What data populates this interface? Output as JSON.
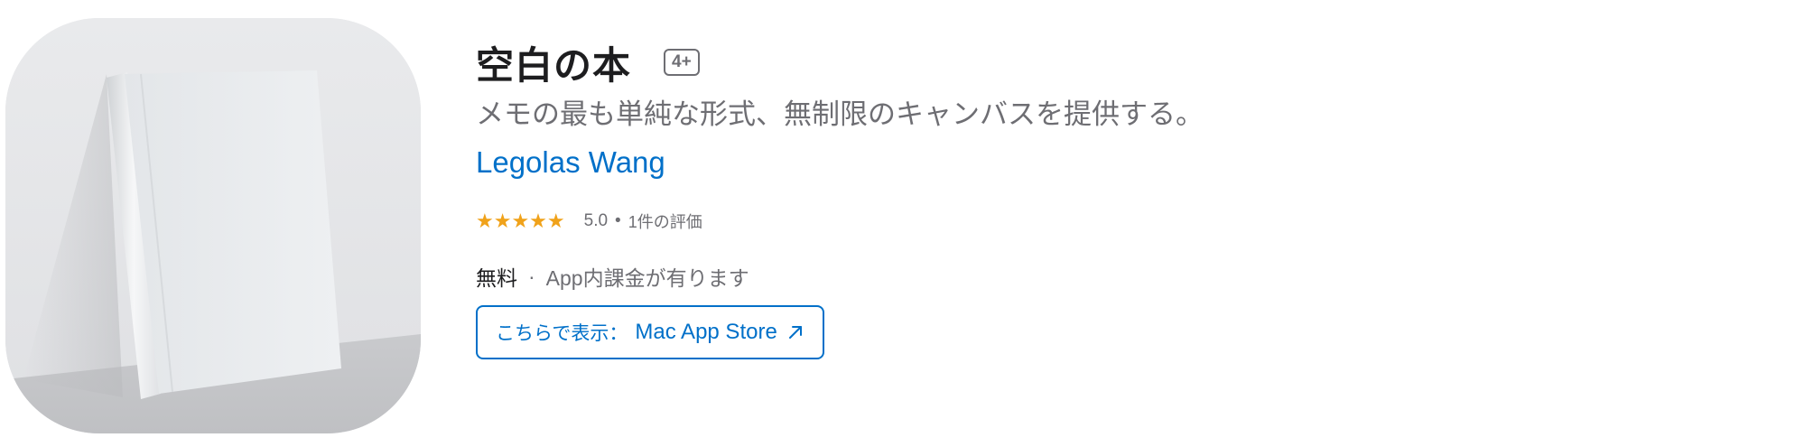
{
  "app": {
    "title": "空白の本",
    "age_rating": "4+",
    "subtitle": "メモの最も単純な形式、無制限のキャンバスを提供する。",
    "developer": "Legolas Wang",
    "icon": "blank-book-icon"
  },
  "rating": {
    "stars": 5.0,
    "stars_display": "★★★★★",
    "value": "5.0",
    "separator": "•",
    "count": "1件の評価",
    "star_color": "#f0a21a"
  },
  "pricing": {
    "price": "無料",
    "separator": "·",
    "iap_note": "App内課金が有ります"
  },
  "store_button": {
    "prefix": "こちらで表示：",
    "store": "Mac App Store",
    "icon": "arrow-up-right-icon"
  },
  "colors": {
    "link": "#0070c9",
    "text": "#1d1d1f",
    "secondary": "#6e6e73"
  }
}
